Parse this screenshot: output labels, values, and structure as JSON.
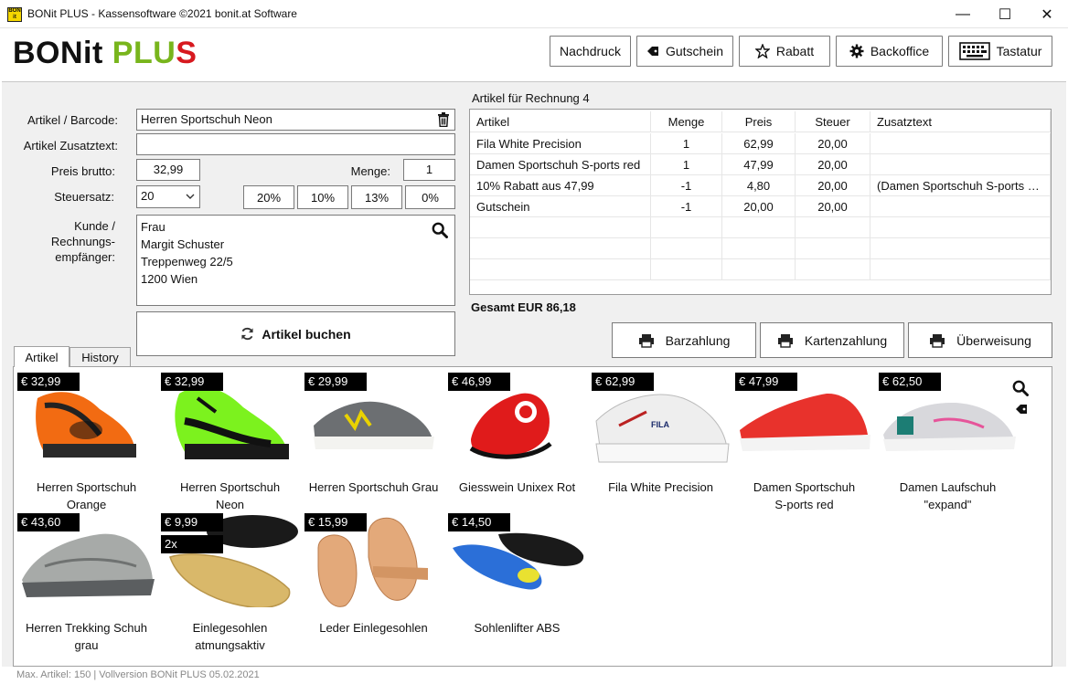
{
  "window": {
    "title": "BONit PLUS - Kassensoftware ©2021 bonit.at Software",
    "icon_text": "BON it",
    "minimize": "—",
    "maximize": "☐",
    "close": "✕"
  },
  "logo": {
    "part1": "BONit ",
    "part2": "PLU",
    "part3": "S"
  },
  "toolbar": {
    "nachdruck": "Nachdruck",
    "gutschein": "Gutschein",
    "rabatt": "Rabatt",
    "backoffice": "Backoffice",
    "tastatur": "Tastatur"
  },
  "form": {
    "artikel_label": "Artikel / Barcode:",
    "artikel_value": "Herren Sportschuh Neon",
    "zusatztext_label": "Artikel Zusatztext:",
    "zusatztext_value": "",
    "preis_label": "Preis brutto:",
    "preis_value": "32,99",
    "menge_label": "Menge:",
    "menge_value": "1",
    "steuersatz_label": "Steuersatz:",
    "steuersatz_value": "20",
    "tax_buttons": [
      "20%",
      "10%",
      "13%",
      "0%"
    ],
    "kunde_label_1": "Kunde /",
    "kunde_label_2": "Rechnungs-",
    "kunde_label_3": "empfänger:",
    "customer": [
      "Frau",
      "Margit Schuster",
      "Treppenweg 22/5",
      "1200 Wien"
    ],
    "buchen_label": "Artikel buchen"
  },
  "invoice": {
    "title": "Artikel für Rechnung 4",
    "columns": [
      "Artikel",
      "Menge",
      "Preis",
      "Steuer",
      "Zusatztext"
    ],
    "rows": [
      [
        "Fila White Precision",
        "1",
        "62,99",
        "20,00",
        ""
      ],
      [
        "Damen Sportschuh S-ports red",
        "1",
        "47,99",
        "20,00",
        ""
      ],
      [
        "10% Rabatt aus 47,99",
        "-1",
        "4,80",
        "20,00",
        "(Damen Sportschuh S-ports red)"
      ],
      [
        "Gutschein",
        "-1",
        "20,00",
        "20,00",
        ""
      ]
    ],
    "total": "Gesamt EUR 86,18"
  },
  "payment": {
    "bar": "Barzahlung",
    "karte": "Kartenzahlung",
    "ueberweisung": "Überweisung"
  },
  "tabs": {
    "artikel": "Artikel",
    "history": "History"
  },
  "products": [
    {
      "price": "€ 32,99",
      "name1": "Herren Sportschuh",
      "name2": "Orange",
      "color": "#f26b12"
    },
    {
      "price": "€ 32,99",
      "name1": "Herren Sportschuh",
      "name2": "Neon",
      "color": "#7cf21e"
    },
    {
      "price": "€ 29,99",
      "name1": "Herren Sportschuh Grau",
      "name2": "",
      "color": "#6c6f72"
    },
    {
      "price": "€ 46,99",
      "name1": "Giesswein Unixex Rot",
      "name2": "",
      "color": "#e01b1b"
    },
    {
      "price": "€ 62,99",
      "name1": "Fila White Precision",
      "name2": "",
      "color": "#e9e9e9"
    },
    {
      "price": "€ 47,99",
      "name1": "Damen Sportschuh",
      "name2": "S-ports red",
      "color": "#e8322c"
    },
    {
      "price": "€ 62,50",
      "name1": "Damen Laufschuh",
      "name2": "\"expand\"",
      "color": "#d8d8dc"
    },
    {
      "price": "€ 43,60",
      "name1": "Herren Trekking Schuh",
      "name2": "grau",
      "color": "#a7aaa8"
    },
    {
      "price": "€ 9,99",
      "qty": "2x",
      "name1": "Einlegesohlen",
      "name2": "atmungsaktiv",
      "color": "#d9b86a"
    },
    {
      "price": "€ 15,99",
      "name1": "Leder Einlegesohlen",
      "name2": "",
      "color": "#e3a97a"
    },
    {
      "price": "€ 14,50",
      "name1": "Sohlenlifter ABS",
      "name2": "",
      "color": "#2b6fd8"
    }
  ],
  "status": "Max. Artikel: 150 | Vollversion BONit PLUS 05.02.2021"
}
